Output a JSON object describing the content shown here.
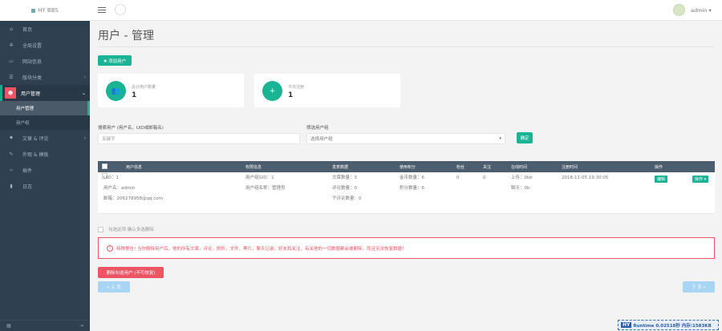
{
  "topbar": {
    "brand": "HY BBS",
    "username": "admin",
    "username_caret": "▾"
  },
  "sidebar": {
    "items": [
      {
        "name": "home",
        "label": "首页",
        "icon": "home-icon",
        "glyph": "⌂"
      },
      {
        "name": "global-settings",
        "label": "全局设置",
        "icon": "gear-icon",
        "glyph": "✲"
      },
      {
        "name": "site-info",
        "label": "网站信息",
        "icon": "monitor-icon",
        "glyph": "▭"
      },
      {
        "name": "forum-category",
        "label": "版块分类",
        "icon": "list-icon",
        "glyph": "☰",
        "arrow": "›"
      },
      {
        "name": "user-manage",
        "label": "用户管理",
        "icon": "users-icon",
        "glyph": "☻",
        "arrow": "⌄"
      },
      {
        "name": "post-comment",
        "label": "文章 & 评论",
        "icon": "tag-icon",
        "glyph": "⬥",
        "arrow": "›"
      },
      {
        "name": "theme-template",
        "label": "外观 & 模板",
        "icon": "brush-icon",
        "glyph": "✎"
      },
      {
        "name": "plugins",
        "label": "插件",
        "icon": "code-icon",
        "glyph": "‹›"
      },
      {
        "name": "logs",
        "label": "日志",
        "icon": "book-icon",
        "glyph": "▮"
      }
    ],
    "subitems": [
      {
        "label": "用户管理"
      },
      {
        "label": "用户组"
      }
    ],
    "footer_left_icon": "grid-icon",
    "footer_right_icon": "logout-icon",
    "footer_left_glyph": "▦",
    "footer_right_glyph": "⇥"
  },
  "main": {
    "title": "用户 - 管理",
    "add_user": "✚ 添加用户",
    "cards": [
      {
        "label": "总计用户数量",
        "value": "1",
        "icon": "group-icon",
        "glyph": "👥"
      },
      {
        "label": "今日注册",
        "value": "1",
        "icon": "user-add-icon",
        "glyph": "+"
      }
    ],
    "search": {
      "label": "搜索用户 (用户名，UID或邮箱名)",
      "placeholder": "关键字",
      "group_label": "筛选用户组",
      "group_selected": "选择用户组",
      "group_caret": "▾",
      "submit": "确定"
    },
    "table": {
      "headers": [
        "",
        "用户信息",
        "权限信息",
        "发表数据",
        "使用积分",
        "粉丝",
        "关注",
        "在线时间",
        "注册时间",
        "操作"
      ],
      "row": {
        "uid": "UID：1",
        "username": "用户名：admin",
        "email": "邮箱：206278958@qq.com",
        "group_id": "用户组GID：1",
        "group_name": "用户组名称：管理员",
        "posts": "文章数量：3",
        "comments": "评论数量：0",
        "subcomments": "子评论数量：0",
        "gold": "金币数量：6",
        "points": "积分数量：6",
        "fans": "0",
        "follows": "0",
        "upload": "上传：0kb",
        "chat": "聊天：0b",
        "reg_time": "2018-11-05 19:30:05",
        "edit": "编辑",
        "action": "操作 ▾"
      }
    },
    "select_all_note": "勾选此项 确认多选删除",
    "warning": "特殊警告! 当你删除用户后，他的所有文章，评论，附件，文件，黑片，聊天记录，好友和关注，有关他的一切数据都会被删除，而且无法恢复数据！",
    "warning_icon": "!",
    "delete_button": "删除勾选用户 (不可恢复)",
    "prev": "« 上 页",
    "next": "下 页 »",
    "debug": {
      "badge": "HY",
      "text": "Runtime 0.02518秒 内存:1583KB"
    }
  }
}
